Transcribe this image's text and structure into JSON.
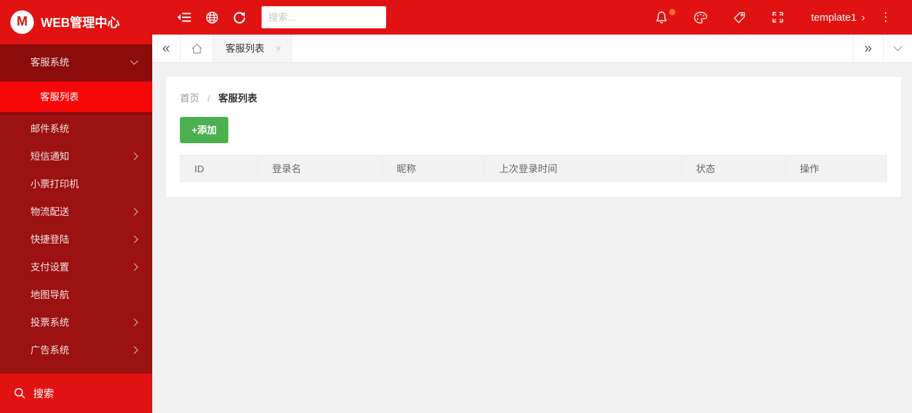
{
  "colors": {
    "header_red": "#e01212",
    "sidebar_red": "#9c1111",
    "sidebar_expanded_red": "#8c0b0b",
    "active_item_red": "#f60808",
    "button_green": "#4caf50",
    "notification_badge_orange": "#ff6b35"
  },
  "brand": {
    "logo_letter": "M",
    "title": "WEB管理中心"
  },
  "topbar": {
    "search": {
      "placeholder": "搜索...",
      "value": ""
    },
    "template_label": "template1",
    "template_chevron_glyph": "›",
    "more_glyph": "⋮",
    "icons": [
      "menu-collapse-icon",
      "globe-icon",
      "refresh-icon",
      "bell-icon",
      "palette-icon",
      "tag-icon",
      "fullscreen-icon",
      "more-vertical-icon"
    ],
    "notification_dot_visible": true
  },
  "tabbar": {
    "back_glyph": "«",
    "forward_glyph": "»",
    "tabs": [
      {
        "label": "客服列表",
        "active": true,
        "closable": true,
        "close_glyph": "×"
      }
    ]
  },
  "sidebar": {
    "menu": [
      {
        "label": "客服系统",
        "expanded": true,
        "children": [
          {
            "label": "客服列表",
            "active": true
          }
        ]
      },
      {
        "label": "邮件系统",
        "has_children": false
      },
      {
        "label": "短信通知",
        "has_children": true
      },
      {
        "label": "小票打印机",
        "has_children": false
      },
      {
        "label": "物流配送",
        "has_children": true
      },
      {
        "label": "快捷登陆",
        "has_children": true
      },
      {
        "label": "支付设置",
        "has_children": true
      },
      {
        "label": "地图导航",
        "has_children": false
      },
      {
        "label": "投票系统",
        "has_children": true
      },
      {
        "label": "广告系统",
        "has_children": true
      }
    ],
    "search_label": "搜索"
  },
  "main": {
    "breadcrumb": {
      "home": "首页",
      "separator": "/",
      "current": "客服列表"
    },
    "add_button_label": "+添加",
    "table": {
      "columns": [
        "ID",
        "登录名",
        "昵称",
        "上次登录时间",
        "状态",
        "操作"
      ],
      "rows": []
    }
  }
}
